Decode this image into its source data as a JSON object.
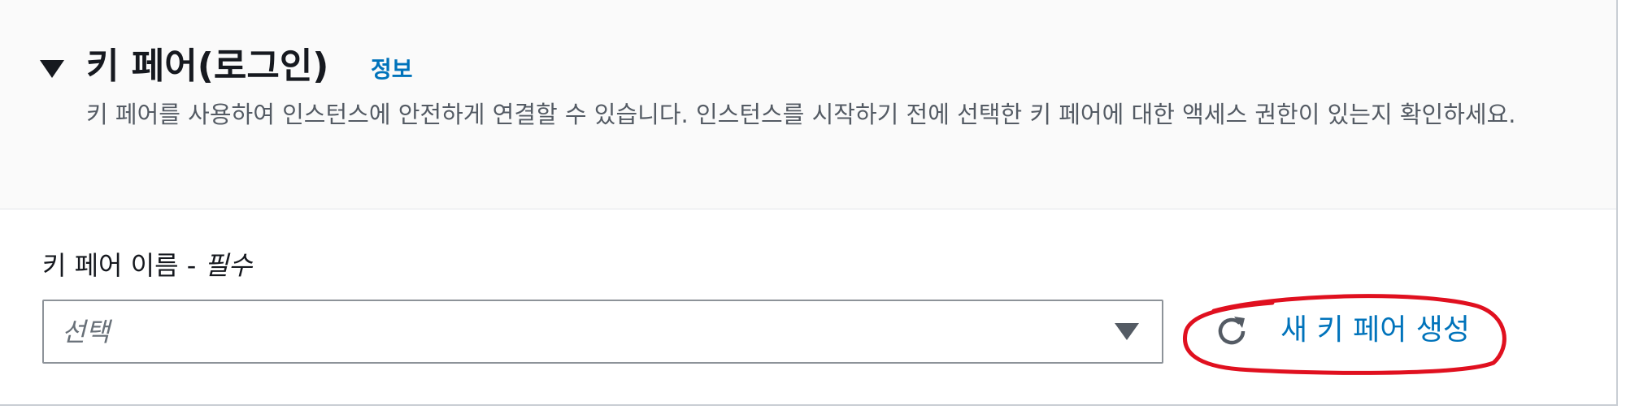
{
  "key_pair_section": {
    "title": "키 페어(로그인)",
    "info_link": "정보",
    "description": "키 페어를 사용하여 인스턴스에 안전하게 연결할 수 있습니다. 인스턴스를 시작하기 전에 선택한 키 페어에 대한 액세스 권한이 있는지 확인하세요.",
    "expanded": true
  },
  "key_pair_name_field": {
    "label": "키 페어 이름 - ",
    "required_text": "필수",
    "placeholder": "선택"
  },
  "create_key_pair_action": {
    "label": "새 키 페어 생성",
    "icon": "refresh-icon"
  },
  "colors": {
    "link": "#0073bb",
    "annotation": "#e0101f",
    "header_background": "#fafafa"
  }
}
